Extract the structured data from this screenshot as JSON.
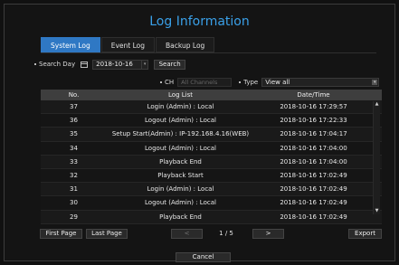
{
  "title": "Log Information",
  "tabs": [
    {
      "label": "System Log",
      "active": true
    },
    {
      "label": "Event Log",
      "active": false
    },
    {
      "label": "Backup Log",
      "active": false
    }
  ],
  "search": {
    "day_label": "Search Day",
    "date_value": "2018-10-16",
    "search_label": "Search"
  },
  "filters": {
    "ch_label": "CH",
    "ch_value": "All Channels",
    "type_label": "Type",
    "type_value": "View all"
  },
  "table": {
    "headers": [
      "No.",
      "Log List",
      "Date/Time"
    ],
    "rows": [
      {
        "no": "37",
        "log": "Login (Admin) : Local",
        "time": "2018-10-16 17:29:57"
      },
      {
        "no": "36",
        "log": "Logout (Admin) : Local",
        "time": "2018-10-16 17:22:33"
      },
      {
        "no": "35",
        "log": "Setup Start(Admin) : IP-192.168.4.16(WEB)",
        "time": "2018-10-16 17:04:17"
      },
      {
        "no": "34",
        "log": "Logout (Admin) : Local",
        "time": "2018-10-16 17:04:00"
      },
      {
        "no": "33",
        "log": "Playback End",
        "time": "2018-10-16 17:04:00"
      },
      {
        "no": "32",
        "log": "Playback Start",
        "time": "2018-10-16 17:02:49"
      },
      {
        "no": "31",
        "log": "Login (Admin) : Local",
        "time": "2018-10-16 17:02:49"
      },
      {
        "no": "30",
        "log": "Logout (Admin) : Local",
        "time": "2018-10-16 17:02:49"
      },
      {
        "no": "29",
        "log": "Playback End",
        "time": "2018-10-16 17:02:49"
      }
    ]
  },
  "pager": {
    "first_label": "First Page",
    "last_label": "Last Page",
    "prev_label": "<",
    "next_label": ">",
    "page_text": "1 / 5",
    "export_label": "Export"
  },
  "cancel_label": "Cancel",
  "colors": {
    "accent": "#2f78c4",
    "title": "#3aa0e8"
  }
}
